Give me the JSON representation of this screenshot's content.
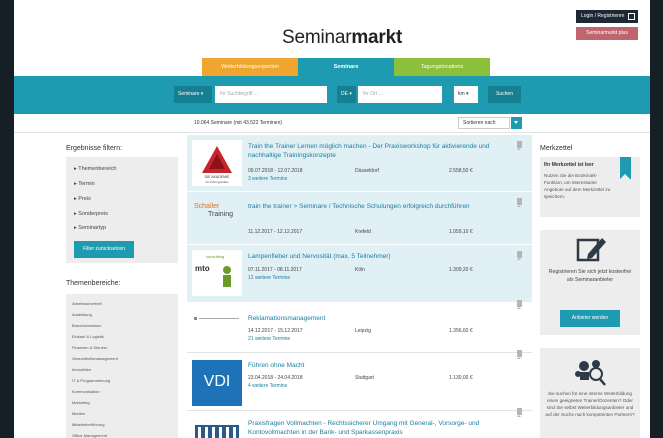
{
  "header": {
    "login_label": "Login / Registrieren",
    "promo_label": "Seminarmarkt plus",
    "logo_regular": "Seminar",
    "logo_bold": "markt"
  },
  "tabs": [
    {
      "label": "Weiterbildungsexperten",
      "color": "#f0a52e"
    },
    {
      "label": "Seminare",
      "color": "#1e9bb0"
    },
    {
      "label": "Tagungslocations",
      "color": "#8cbf3a"
    }
  ],
  "search": {
    "type_select": "Seminare ▾",
    "keyword_placeholder": "Ihr Suchbegriff ...",
    "country_select": "DE ▾",
    "city_placeholder": "Ihr Ort ...",
    "radius_select": "km ▾",
    "search_button": "Suchen"
  },
  "results_header": {
    "count_text": "10.064 Seminare (mit 43.522 Terminen)",
    "sort_label": "Sortieren nach"
  },
  "filters": {
    "title": "Ergebnisse filtern:",
    "items": [
      "Themenbereich",
      "Termin",
      "Preis",
      "Sonderpreis",
      "Seminartyp"
    ],
    "reset_button": "Filter zurücksetzen"
  },
  "themes": {
    "title": "Themenbereiche:",
    "items": [
      "Arbeitssicherheit",
      "Ausbildung",
      "Branchenwissen",
      "Einkauf & Logistik",
      "Finanzen & Steuern",
      "Gesundheitsmanagement",
      "Immobilien",
      "IT & Programmierung",
      "Kommunikation",
      "Marketing",
      "Medien",
      "Mitarbeiterführung",
      "Office-Management"
    ]
  },
  "results": [
    {
      "title": "Train the Trainer Lernen möglich machen - Der Praxisworkshop für aktivierende und nachhaltige Trainingskonzepte",
      "date": "09.07.2018 - 12.07.2018",
      "location": "Düsseldorf",
      "price": "2.558,50 €",
      "more": "3 weitere Termine",
      "logo_text": "DIE AKADEMIE",
      "logo_sub": "für Führungskräfte"
    },
    {
      "title": "train the trainer > Seminare / Technische Schulungen erfolgreich durchführen",
      "date": "11.12.2017 - 12.12.2017",
      "location": "Krefeld",
      "price": "1.059,10 €",
      "more": "",
      "logo_text": "Schaller",
      "logo_sub": "Training"
    },
    {
      "title": "Lampenfieber und Nervosität (max. 5 Teilnehmer)",
      "date": "07.11.2017 - 08.11.2017",
      "location": "Köln",
      "price": "1.309,20 €",
      "more": "12 weitere Termine",
      "logo_text": "mto",
      "logo_sub": "consulting"
    },
    {
      "title": "Reklamationsmanagement",
      "date": "14.12.2017 - 15.12.2017",
      "location": "Leipzig",
      "price": "1.356,60 €",
      "more": "21 weitere Termine",
      "logo_text": "",
      "logo_sub": ""
    },
    {
      "title": "Führen ohne Macht",
      "date": "23.04.2018 - 24.04.2018",
      "location": "Stuttgart",
      "price": "1.130,00 €",
      "more": "4 weitere Termine",
      "logo_text": "VDI",
      "logo_sub": ""
    },
    {
      "title": "Praxisfragen Vollmachten - Rechtssicherer Umgang mit General-, Vorsorge- und Kontovollmachten in der Bank- und Sparkassenpraxis",
      "date": "",
      "location": "",
      "price": "",
      "more": "",
      "logo_text": "",
      "logo_sub": ""
    }
  ],
  "merkzettel": {
    "title": "Merkzettel",
    "empty_heading": "Ihr Merkzettel ist leer",
    "empty_text": "Nutzen Sie die Bookmark-Funktion, um interessante Angebote auf dem Merkzettel zu speichern."
  },
  "provider_box": {
    "text": "Registrieren Sie sich jetzt kostenfrei als Seminaranbieter",
    "button": "Anbieter werden"
  },
  "search_box": {
    "text": "Sie suchen für eine interne Weiterbildung einen geeigneten Trainer/Dozenten? Oder sind Sie selbst Weiterbildungsanbieter und auf der Suche nach kompetenten Partnern?"
  },
  "colors": {
    "teal": "#1e9bb0",
    "orange": "#f0a52e",
    "green": "#8cbf3a",
    "dark": "#1c2833",
    "promo": "#c0646e"
  }
}
